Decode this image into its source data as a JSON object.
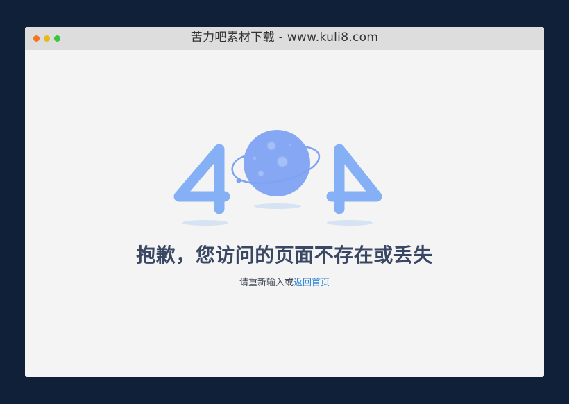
{
  "window": {
    "title": "苦力吧素材下载 - www.kuli8.com",
    "controls": {
      "close_color": "#f4761f",
      "minimize_color": "#e8b91a",
      "maximize_color": "#3cc43a"
    }
  },
  "error": {
    "digits": [
      "4",
      "0",
      "4"
    ],
    "headline": "抱歉，您访问的页面不存在或丢失",
    "hint_text": "请重新输入或",
    "link_text": "返回首页"
  },
  "colors": {
    "background": "#112039",
    "page": "#f4f4f5",
    "accent_blue": "#86b0f5",
    "planet_blue": "#7ea3f2",
    "headline": "#3a4763",
    "link": "#2f86d8"
  }
}
